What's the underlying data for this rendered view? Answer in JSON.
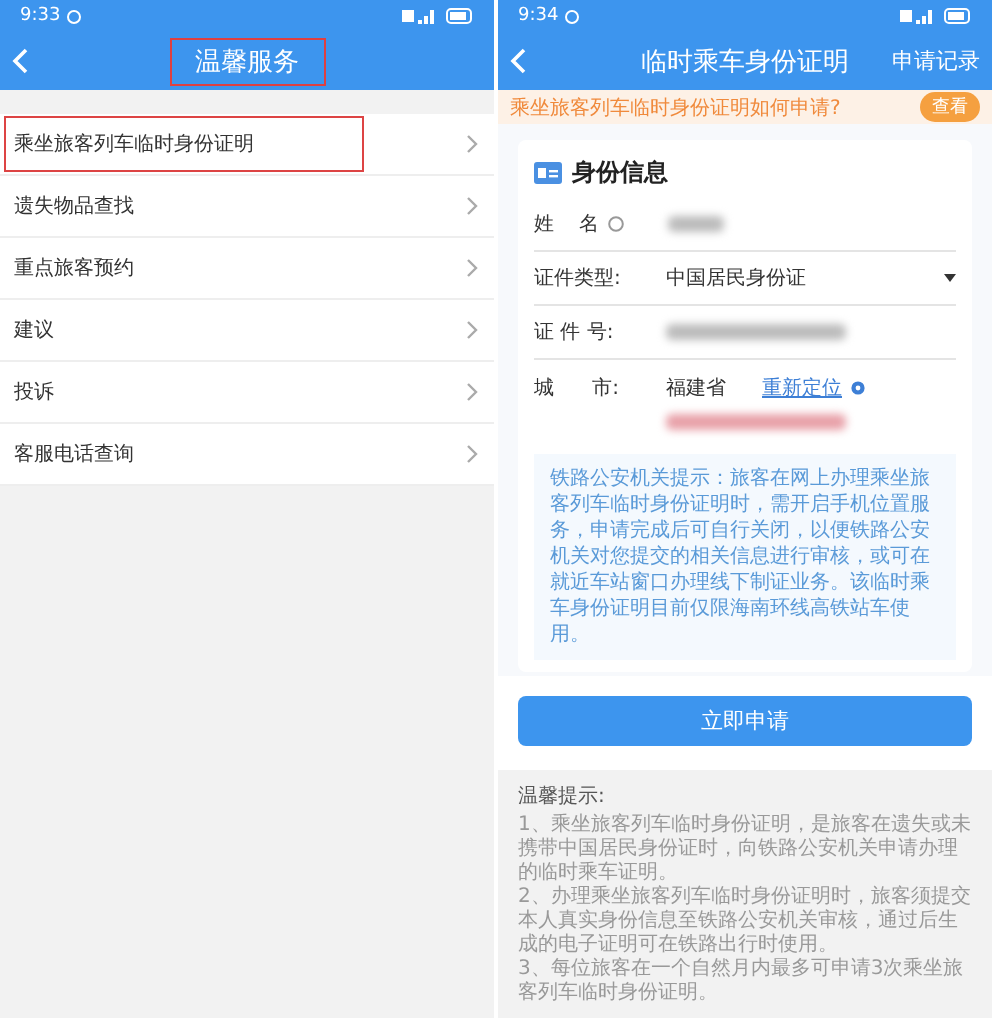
{
  "left": {
    "status_bar": {
      "time": "9:33"
    },
    "title": "温馨服务",
    "title_highlighted": true,
    "items": [
      {
        "label": "乘坐旅客列车临时身份证明",
        "highlighted": true
      },
      {
        "label": "遗失物品查找",
        "highlighted": false
      },
      {
        "label": "重点旅客预约",
        "highlighted": false
      },
      {
        "label": "建议",
        "highlighted": false
      },
      {
        "label": "投诉",
        "highlighted": false
      },
      {
        "label": "客服电话查询",
        "highlighted": false
      }
    ]
  },
  "right": {
    "status_bar": {
      "time": "9:34"
    },
    "title": "临时乘车身份证明",
    "nav_action": "申请记录",
    "banner": {
      "text": "乘坐旅客列车临时身份证明如何申请?",
      "button": "查看"
    },
    "card_title": "身份信息",
    "fields": [
      {
        "label": "姓    名",
        "kind": "redacted"
      },
      {
        "label": "证件类型:",
        "kind": "select",
        "value": "中国居民身份证"
      },
      {
        "label": "证 件 号:",
        "kind": "redacted"
      },
      {
        "label": "城      市:",
        "kind": "location",
        "value": "福建省",
        "link": "重新定位"
      }
    ],
    "notice": "铁路公安机关提示：旅客在网上办理乘坐旅客列车临时身份证明时，需开启手机位置服务，申请完成后可自行关闭，以便铁路公安机关对您提交的相关信息进行审核，或可在就近车站窗口办理线下制证业务。该临时乘车身份证明目前仅限海南环线高铁站车使用。",
    "submit": "立即申请",
    "tips_title": "温馨提示:",
    "tips": [
      "1、乘坐旅客列车临时身份证明，是旅客在遗失或未携带中国居民身份证时，向铁路公安机关申请办理的临时乘车证明。",
      "2、办理乘坐旅客列车临时身份证明时，旅客须提交本人真实身份信息至铁路公安机关审核，通过后生成的电子证明可在铁路出行时使用。",
      "3、每位旅客在一个自然月内最多可申请3次乘坐旅客列车临时身份证明。"
    ]
  }
}
